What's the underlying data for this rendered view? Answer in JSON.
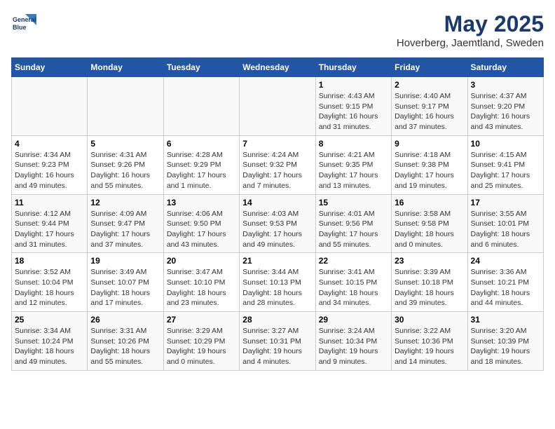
{
  "header": {
    "logo_line1": "General",
    "logo_line2": "Blue",
    "title": "May 2025",
    "subtitle": "Hoverberg, Jaemtland, Sweden"
  },
  "weekdays": [
    "Sunday",
    "Monday",
    "Tuesday",
    "Wednesday",
    "Thursday",
    "Friday",
    "Saturday"
  ],
  "weeks": [
    [
      {
        "day": "",
        "info": ""
      },
      {
        "day": "",
        "info": ""
      },
      {
        "day": "",
        "info": ""
      },
      {
        "day": "",
        "info": ""
      },
      {
        "day": "1",
        "info": "Sunrise: 4:43 AM\nSunset: 9:15 PM\nDaylight: 16 hours\nand 31 minutes."
      },
      {
        "day": "2",
        "info": "Sunrise: 4:40 AM\nSunset: 9:17 PM\nDaylight: 16 hours\nand 37 minutes."
      },
      {
        "day": "3",
        "info": "Sunrise: 4:37 AM\nSunset: 9:20 PM\nDaylight: 16 hours\nand 43 minutes."
      }
    ],
    [
      {
        "day": "4",
        "info": "Sunrise: 4:34 AM\nSunset: 9:23 PM\nDaylight: 16 hours\nand 49 minutes."
      },
      {
        "day": "5",
        "info": "Sunrise: 4:31 AM\nSunset: 9:26 PM\nDaylight: 16 hours\nand 55 minutes."
      },
      {
        "day": "6",
        "info": "Sunrise: 4:28 AM\nSunset: 9:29 PM\nDaylight: 17 hours\nand 1 minute."
      },
      {
        "day": "7",
        "info": "Sunrise: 4:24 AM\nSunset: 9:32 PM\nDaylight: 17 hours\nand 7 minutes."
      },
      {
        "day": "8",
        "info": "Sunrise: 4:21 AM\nSunset: 9:35 PM\nDaylight: 17 hours\nand 13 minutes."
      },
      {
        "day": "9",
        "info": "Sunrise: 4:18 AM\nSunset: 9:38 PM\nDaylight: 17 hours\nand 19 minutes."
      },
      {
        "day": "10",
        "info": "Sunrise: 4:15 AM\nSunset: 9:41 PM\nDaylight: 17 hours\nand 25 minutes."
      }
    ],
    [
      {
        "day": "11",
        "info": "Sunrise: 4:12 AM\nSunset: 9:44 PM\nDaylight: 17 hours\nand 31 minutes."
      },
      {
        "day": "12",
        "info": "Sunrise: 4:09 AM\nSunset: 9:47 PM\nDaylight: 17 hours\nand 37 minutes."
      },
      {
        "day": "13",
        "info": "Sunrise: 4:06 AM\nSunset: 9:50 PM\nDaylight: 17 hours\nand 43 minutes."
      },
      {
        "day": "14",
        "info": "Sunrise: 4:03 AM\nSunset: 9:53 PM\nDaylight: 17 hours\nand 49 minutes."
      },
      {
        "day": "15",
        "info": "Sunrise: 4:01 AM\nSunset: 9:56 PM\nDaylight: 17 hours\nand 55 minutes."
      },
      {
        "day": "16",
        "info": "Sunrise: 3:58 AM\nSunset: 9:58 PM\nDaylight: 18 hours\nand 0 minutes."
      },
      {
        "day": "17",
        "info": "Sunrise: 3:55 AM\nSunset: 10:01 PM\nDaylight: 18 hours\nand 6 minutes."
      }
    ],
    [
      {
        "day": "18",
        "info": "Sunrise: 3:52 AM\nSunset: 10:04 PM\nDaylight: 18 hours\nand 12 minutes."
      },
      {
        "day": "19",
        "info": "Sunrise: 3:49 AM\nSunset: 10:07 PM\nDaylight: 18 hours\nand 17 minutes."
      },
      {
        "day": "20",
        "info": "Sunrise: 3:47 AM\nSunset: 10:10 PM\nDaylight: 18 hours\nand 23 minutes."
      },
      {
        "day": "21",
        "info": "Sunrise: 3:44 AM\nSunset: 10:13 PM\nDaylight: 18 hours\nand 28 minutes."
      },
      {
        "day": "22",
        "info": "Sunrise: 3:41 AM\nSunset: 10:15 PM\nDaylight: 18 hours\nand 34 minutes."
      },
      {
        "day": "23",
        "info": "Sunrise: 3:39 AM\nSunset: 10:18 PM\nDaylight: 18 hours\nand 39 minutes."
      },
      {
        "day": "24",
        "info": "Sunrise: 3:36 AM\nSunset: 10:21 PM\nDaylight: 18 hours\nand 44 minutes."
      }
    ],
    [
      {
        "day": "25",
        "info": "Sunrise: 3:34 AM\nSunset: 10:24 PM\nDaylight: 18 hours\nand 49 minutes."
      },
      {
        "day": "26",
        "info": "Sunrise: 3:31 AM\nSunset: 10:26 PM\nDaylight: 18 hours\nand 55 minutes."
      },
      {
        "day": "27",
        "info": "Sunrise: 3:29 AM\nSunset: 10:29 PM\nDaylight: 19 hours\nand 0 minutes."
      },
      {
        "day": "28",
        "info": "Sunrise: 3:27 AM\nSunset: 10:31 PM\nDaylight: 19 hours\nand 4 minutes."
      },
      {
        "day": "29",
        "info": "Sunrise: 3:24 AM\nSunset: 10:34 PM\nDaylight: 19 hours\nand 9 minutes."
      },
      {
        "day": "30",
        "info": "Sunrise: 3:22 AM\nSunset: 10:36 PM\nDaylight: 19 hours\nand 14 minutes."
      },
      {
        "day": "31",
        "info": "Sunrise: 3:20 AM\nSunset: 10:39 PM\nDaylight: 19 hours\nand 18 minutes."
      }
    ]
  ]
}
